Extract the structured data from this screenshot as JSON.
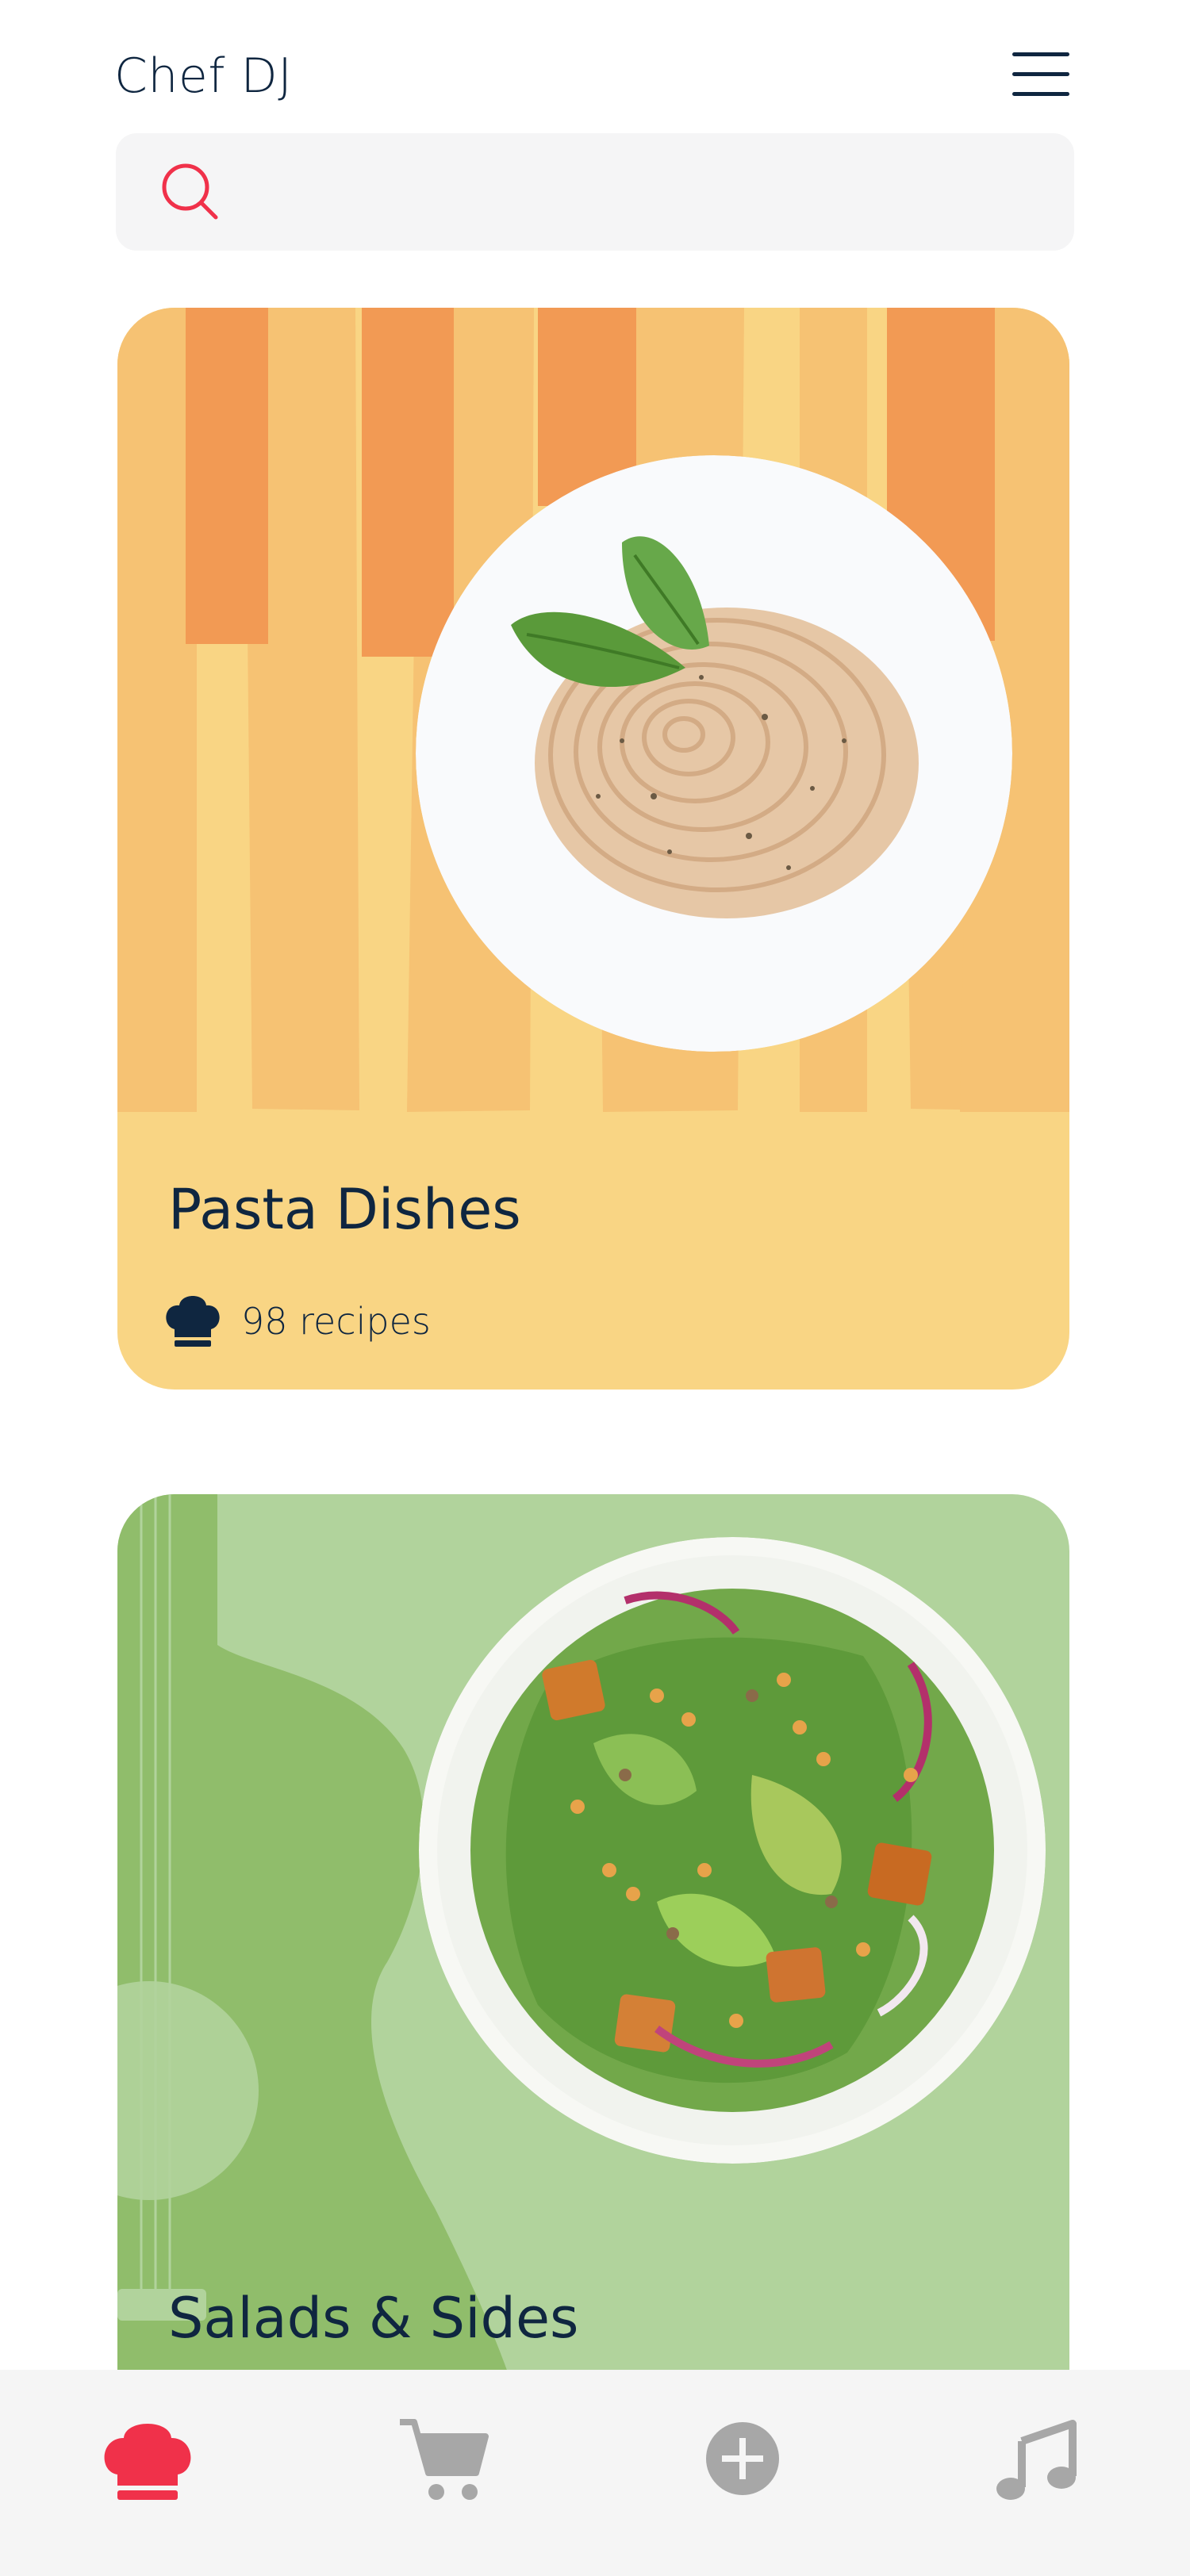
{
  "header": {
    "title": "Chef DJ",
    "menu_icon": "hamburger-menu-icon"
  },
  "search": {
    "placeholder": "",
    "value": "",
    "icon": "search-icon"
  },
  "categories": [
    {
      "title": "Pasta Dishes",
      "recipe_count": "98 recipes",
      "icon": "chef-hat-icon",
      "image": "pasta-dish-photo",
      "background_color": "#f9d584",
      "accent_colors": [
        "#f6c273",
        "#f29a54"
      ]
    },
    {
      "title": "Salads & Sides",
      "image": "salad-dish-photo",
      "background_color": "#b1d39c",
      "accent_colors": [
        "#90bd6b"
      ]
    }
  ],
  "bottom_nav": {
    "items": [
      {
        "name": "home",
        "icon": "chef-hat-icon",
        "active": true
      },
      {
        "name": "cart",
        "icon": "cart-icon",
        "active": false
      },
      {
        "name": "add",
        "icon": "plus-circle-icon",
        "active": false
      },
      {
        "name": "music",
        "icon": "music-note-icon",
        "active": false
      }
    ]
  },
  "colors": {
    "primary_text": "#0f2640",
    "accent": "#f0314a",
    "inactive_icon": "#a7a7a7",
    "nav_background": "#f5f5f5",
    "search_background": "#f5f5f6"
  }
}
